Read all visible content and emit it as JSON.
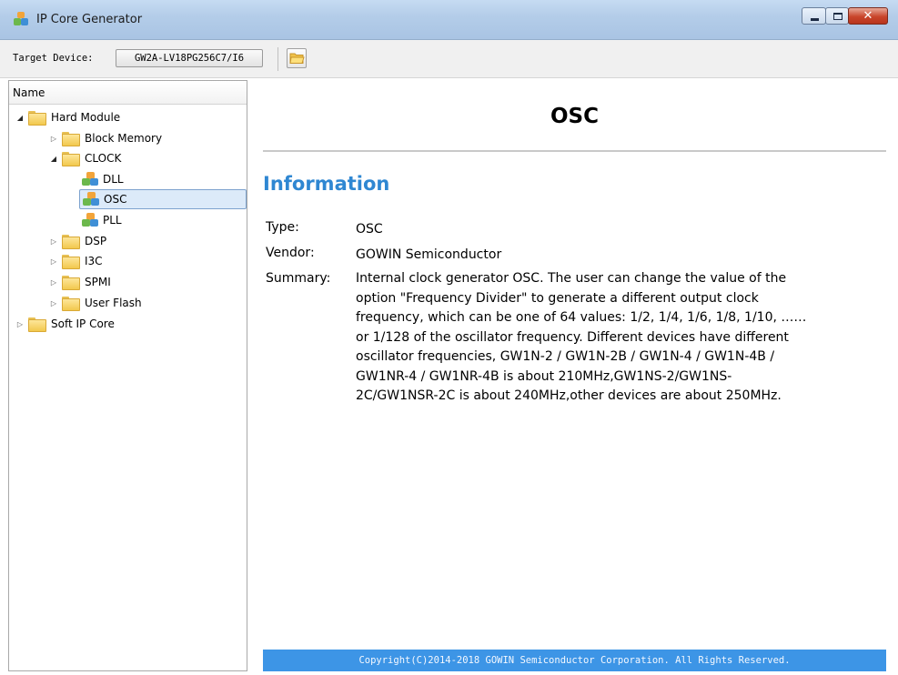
{
  "window": {
    "title": "IP Core Generator",
    "close_glyph": "✕"
  },
  "toolbar": {
    "target_label": "Target Device:",
    "target_device": "GW2A-LV18PG256C7/I6",
    "open_icon": "folder-open-icon"
  },
  "tree": {
    "header": "Name",
    "items": [
      {
        "label": "Hard Module",
        "expanded": true,
        "type": "folder"
      },
      {
        "label": "Block Memory",
        "expanded": false,
        "type": "folder"
      },
      {
        "label": "CLOCK",
        "expanded": true,
        "type": "folder"
      },
      {
        "label": "DLL",
        "type": "ip"
      },
      {
        "label": "OSC",
        "type": "ip",
        "selected": true
      },
      {
        "label": "PLL",
        "type": "ip"
      },
      {
        "label": "DSP",
        "expanded": false,
        "type": "folder"
      },
      {
        "label": "I3C",
        "expanded": false,
        "type": "folder"
      },
      {
        "label": "SPMI",
        "expanded": false,
        "type": "folder"
      },
      {
        "label": "User Flash",
        "expanded": false,
        "type": "folder"
      },
      {
        "label": "Soft IP Core",
        "expanded": false,
        "type": "folder"
      }
    ]
  },
  "content": {
    "title": "OSC",
    "section_heading": "Information",
    "type_label": "Type:",
    "type_value": "OSC",
    "vendor_label": "Vendor:",
    "vendor_value": "GOWIN Semiconductor",
    "summary_label": "Summary:",
    "summary_lines": [
      "Internal clock generator OSC. The user can change the value of the",
      "option \"Frequency Divider\" to generate a different output clock",
      "frequency, which can be one of 64 values: 1/2, 1/4, 1/6, 1/8, 1/10, ……",
      "or 1/128 of the oscillator frequency. Different devices have different",
      "oscillator frequencies, GW1N-2 / GW1N-2B / GW1N-4 / GW1N-4B /",
      "GW1NR-4 / GW1NR-4B is about 210MHz,GW1NS-2/GW1NS-",
      "2C/GW1NSR-2C is about 240MHz,other devices are about 250MHz."
    ],
    "footer": "Copyright(C)2014-2018 GOWIN Semiconductor Corporation. All Rights Reserved."
  },
  "colors": {
    "accent": "#2f87d2",
    "footer_bg": "#3d95e6",
    "selection": "#dceaf9"
  }
}
